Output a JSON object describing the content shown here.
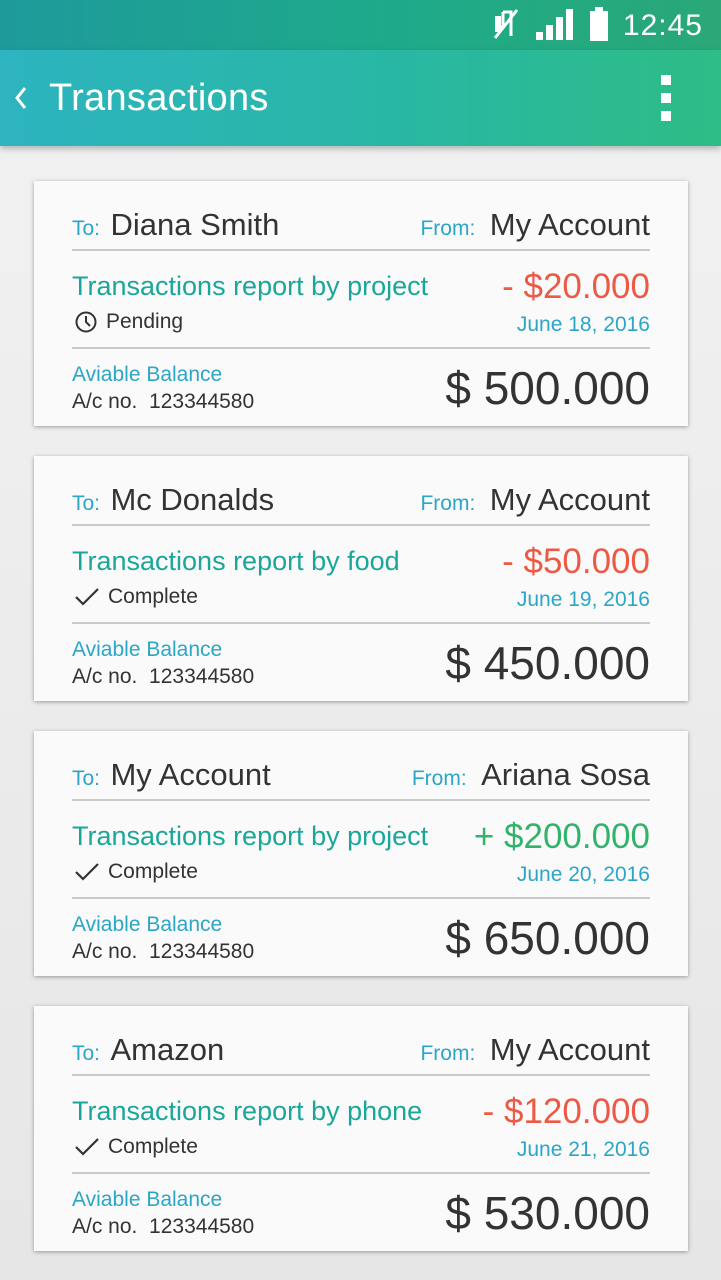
{
  "status_bar": {
    "time": "12:45",
    "icons": [
      "mute-icon",
      "signal-icon",
      "battery-icon"
    ]
  },
  "app_bar": {
    "title": "Transactions",
    "back_icon": "chevron-left-icon",
    "menu_icon": "more-vert-icon"
  },
  "labels": {
    "to": "To:",
    "from": "From:",
    "balance": "Aviable Balance",
    "acct_prefix": "A/c no."
  },
  "transactions": [
    {
      "to": "Diana Smith",
      "from": "My Account",
      "report": "Transactions report by project",
      "status": "Pending",
      "status_icon": "clock-icon",
      "amount": "- $20.000",
      "amount_type": "negative",
      "date": "June 18, 2016",
      "account_no": "123344580",
      "balance": "$ 500.000"
    },
    {
      "to": "Mc Donalds",
      "from": "My Account",
      "report": "Transactions report by food",
      "status": "Complete",
      "status_icon": "check-icon",
      "amount": "- $50.000",
      "amount_type": "negative",
      "date": "June 19, 2016",
      "account_no": "123344580",
      "balance": "$ 450.000"
    },
    {
      "to": "My Account",
      "from": "Ariana Sosa",
      "report": "Transactions report by project",
      "status": "Complete",
      "status_icon": "check-icon",
      "amount": "+ $200.000",
      "amount_type": "positive",
      "date": "June 20, 2016",
      "account_no": "123344580",
      "balance": "$ 650.000"
    },
    {
      "to": "Amazon",
      "from": "My Account",
      "report": "Transactions report by phone",
      "status": "Complete",
      "status_icon": "check-icon",
      "amount": "- $120.000",
      "amount_type": "negative",
      "date": "June 21, 2016",
      "account_no": "123344580",
      "balance": "$ 530.000"
    }
  ],
  "colors": {
    "accent_blue": "#2ba6c7",
    "accent_teal": "#1aa79a",
    "negative": "#ec5a46",
    "positive": "#32b36b",
    "text_dark": "#333333"
  }
}
